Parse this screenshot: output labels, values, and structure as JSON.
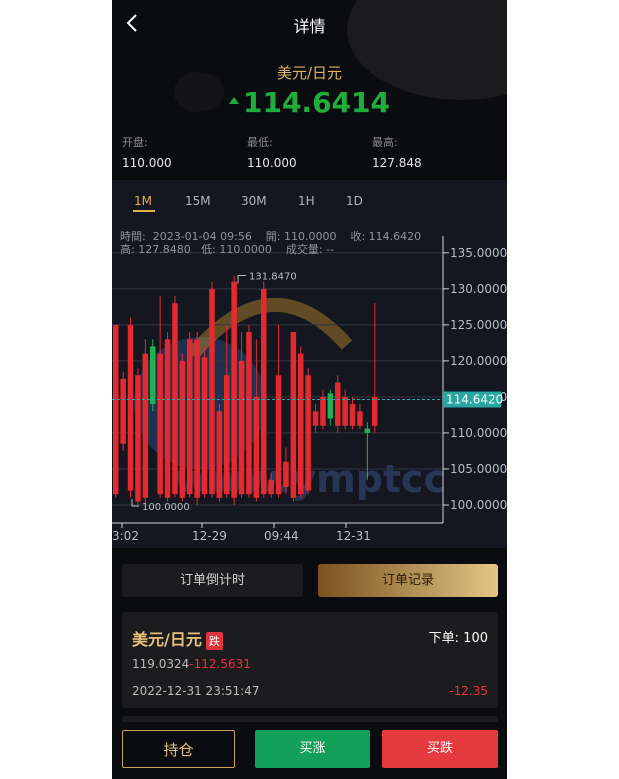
{
  "header": {
    "title": "详情"
  },
  "ticker": {
    "pair": "美元/日元",
    "price": "114.6414",
    "direction": "up",
    "stats": [
      {
        "label": "开盘:",
        "value": "110.000"
      },
      {
        "label": "最低:",
        "value": "110.000"
      },
      {
        "label": "最高:",
        "value": "127.848"
      }
    ]
  },
  "timeframes": {
    "items": [
      "1M",
      "15M",
      "30M",
      "1H",
      "1D"
    ],
    "active": "1M"
  },
  "chart_info": {
    "line1": "時間:  2023-01-04 09:56    開: 110.0000    收: 114.6420",
    "line2": "高: 127.8480   低: 110.0000    成交量: --"
  },
  "chart_data": {
    "type": "candlestick",
    "ylim": [
      97.5,
      136.5
    ],
    "y_ticks": [
      "135.0000",
      "130.0000",
      "125.0000",
      "120.0000",
      "115.0000",
      "110.0000",
      "105.0000",
      "100.0000"
    ],
    "x_ticks": [
      "3:02",
      "12-29",
      "09:44",
      "12-31"
    ],
    "current_price": "114.6420",
    "max_marker": "131.8470",
    "min_marker": "100.0000",
    "watermark": "www.ymptcc",
    "colors": {
      "up": "#22b14c",
      "down": "#e52a2f",
      "current": "#2aa7a3"
    },
    "candles": [
      {
        "o": 125.0,
        "c": 101.5,
        "h": 125.0,
        "l": 101.0
      },
      {
        "o": 117.5,
        "c": 108.5,
        "h": 118.5,
        "l": 107.5
      },
      {
        "o": 125.0,
        "c": 102.0,
        "h": 126.0,
        "l": 101.0
      },
      {
        "o": 118.0,
        "c": 100.5,
        "h": 119.0,
        "l": 100.0
      },
      {
        "o": 121.0,
        "c": 101.0,
        "h": 123.0,
        "l": 100.0
      },
      {
        "o": 114.0,
        "c": 122.0,
        "h": 123.0,
        "l": 113.0
      },
      {
        "o": 121.0,
        "c": 101.5,
        "h": 129.0,
        "l": 101.0
      },
      {
        "o": 123.0,
        "c": 101.0,
        "h": 124.0,
        "l": 100.5
      },
      {
        "o": 128.0,
        "c": 101.5,
        "h": 129.0,
        "l": 101.0
      },
      {
        "o": 120.0,
        "c": 101.0,
        "h": 121.0,
        "l": 100.5
      },
      {
        "o": 123.0,
        "c": 101.5,
        "h": 124.0,
        "l": 101.0
      },
      {
        "o": 123.0,
        "c": 101.0,
        "h": 124.0,
        "l": 100.0
      },
      {
        "o": 120.5,
        "c": 101.5,
        "h": 122.0,
        "l": 101.0
      },
      {
        "o": 130.0,
        "c": 101.5,
        "h": 131.0,
        "l": 101.0
      },
      {
        "o": 113.0,
        "c": 101.0,
        "h": 114.0,
        "l": 100.5
      },
      {
        "o": 118.0,
        "c": 101.5,
        "h": 125.0,
        "l": 101.0
      },
      {
        "o": 131.0,
        "c": 101.0,
        "h": 131.8,
        "l": 100.0
      },
      {
        "o": 120.0,
        "c": 101.5,
        "h": 124.0,
        "l": 101.0
      },
      {
        "o": 124.0,
        "c": 101.5,
        "h": 125.0,
        "l": 101.0
      },
      {
        "o": 115.0,
        "c": 101.0,
        "h": 123.0,
        "l": 100.5
      },
      {
        "o": 130.0,
        "c": 101.5,
        "h": 131.0,
        "l": 101.0
      },
      {
        "o": 103.5,
        "c": 101.5,
        "h": 104.5,
        "l": 101.0
      },
      {
        "o": 118.0,
        "c": 101.5,
        "h": 125.0,
        "l": 101.0
      },
      {
        "o": 106.0,
        "c": 102.5,
        "h": 108.0,
        "l": 101.5
      },
      {
        "o": 124.0,
        "c": 101.0,
        "h": 124.0,
        "l": 100.5
      },
      {
        "o": 121.0,
        "c": 101.5,
        "h": 122.0,
        "l": 101.0
      },
      {
        "o": 118.0,
        "c": 102.0,
        "h": 119.0,
        "l": 101.5
      },
      {
        "o": 113.0,
        "c": 111.0,
        "h": 114.0,
        "l": 110.0
      },
      {
        "o": 115.0,
        "c": 111.0,
        "h": 116.0,
        "l": 110.5
      },
      {
        "o": 112.0,
        "c": 115.5,
        "h": 116.0,
        "l": 111.0
      },
      {
        "o": 117.0,
        "c": 111.0,
        "h": 118.0,
        "l": 110.0
      },
      {
        "o": 115.0,
        "c": 111.0,
        "h": 116.0,
        "l": 110.5
      },
      {
        "o": 114.0,
        "c": 111.0,
        "h": 115.0,
        "l": 110.5
      },
      {
        "o": 113.0,
        "c": 111.0,
        "h": 114.0,
        "l": 110.5
      },
      {
        "o": 110.0,
        "c": 110.6,
        "h": 111.5,
        "l": 103.5
      },
      {
        "o": 115.0,
        "c": 111.0,
        "h": 128.0,
        "l": 110.0
      }
    ]
  },
  "actions": {
    "countdown": "订单倒计时",
    "records": "订单记录"
  },
  "order": {
    "pair": "美元/日元",
    "tag": "跌",
    "qty": "下单:  100",
    "price_open": "119.0324",
    "sep": "-",
    "price_close": "112.5631",
    "time": "2022-12-31 23:51:47",
    "pnl": "-12.35"
  },
  "bottom": {
    "hold": "持仓",
    "buy_up": "买涨",
    "buy_down": "买跌"
  }
}
